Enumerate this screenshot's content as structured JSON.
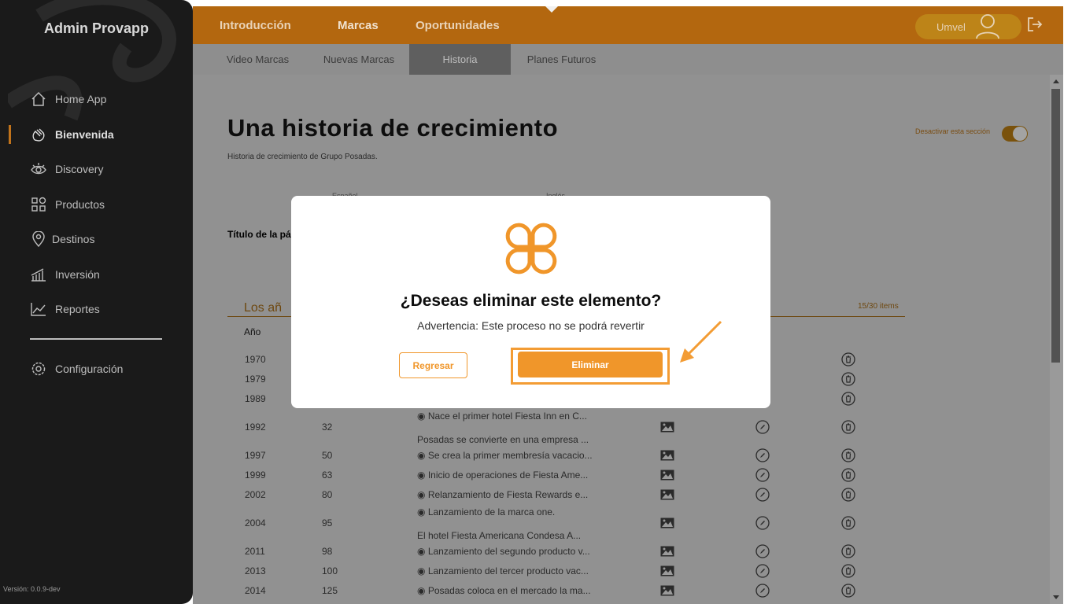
{
  "app": {
    "brand": "Admin Provapp",
    "version": "Versión: 0.0.9-dev"
  },
  "sidebar": {
    "items": [
      {
        "label": "Home App",
        "icon": "home-icon"
      },
      {
        "label": "Bienvenida",
        "icon": "wave-hand-icon",
        "active": true
      },
      {
        "label": "Discovery",
        "icon": "eye-icon"
      },
      {
        "label": "Productos",
        "icon": "grid-icon"
      },
      {
        "label": "Destinos",
        "icon": "location-pin-icon"
      },
      {
        "label": "Inversión",
        "icon": "bar-chart-icon"
      },
      {
        "label": "Reportes",
        "icon": "line-chart-icon"
      },
      {
        "label": "Configuración",
        "icon": "gear-icon"
      }
    ]
  },
  "topnav": {
    "items": [
      "Introducción",
      "Marcas",
      "Oportunidades"
    ],
    "active": "Marcas"
  },
  "user": {
    "name": "Umvel"
  },
  "subnav": {
    "items": [
      "Video Marcas",
      "Nuevas Marcas",
      "Historia",
      "Planes Futuros"
    ],
    "active": "Historia"
  },
  "page": {
    "title": "Una historia de crecimiento",
    "subtitle": "Historia de crecimiento de Grupo Posadas.",
    "toggle_label": "Desactivar esta sección",
    "lang_es": "Español",
    "lang_en": "Inglés",
    "field_label": "Título de la pá",
    "section_title": "Los añ",
    "counter": "15/30 items",
    "col_year": "Año"
  },
  "rows": [
    {
      "year": "1970",
      "num": "",
      "desc": ""
    },
    {
      "year": "1979",
      "num": "",
      "desc": ""
    },
    {
      "year": "1989",
      "num": "",
      "desc": ""
    },
    {
      "year": "1992",
      "num": "32",
      "desc": "Nace el primer hotel Fiesta Inn en C...",
      "desc2": "Posadas se convierte en una empresa ..."
    },
    {
      "year": "1997",
      "num": "50",
      "desc": "Se crea la primer membresía vacacio..."
    },
    {
      "year": "1999",
      "num": "63",
      "desc": "Inicio de operaciones de Fiesta Ame..."
    },
    {
      "year": "2002",
      "num": "80",
      "desc": "Relanzamiento de Fiesta Rewards e..."
    },
    {
      "year": "2004",
      "num": "95",
      "desc": "Lanzamiento de la marca one.",
      "desc2": "El hotel Fiesta Americana Condesa A..."
    },
    {
      "year": "2011",
      "num": "98",
      "desc": "Lanzamiento del segundo producto v..."
    },
    {
      "year": "2013",
      "num": "100",
      "desc": "Lanzamiento del tercer producto vac..."
    },
    {
      "year": "2014",
      "num": "125",
      "desc": "Posadas coloca en el mercado la ma..."
    }
  ],
  "modal": {
    "title": "¿Deseas eliminar este elemento?",
    "warning": "Advertencia: Este proceso no se podrá revertir",
    "cancel_label": "Regresar",
    "confirm_label": "Eliminar"
  },
  "colors": {
    "accent": "#f0962a",
    "topbar": "#b3670f",
    "sidebar": "#1a1a1a"
  }
}
